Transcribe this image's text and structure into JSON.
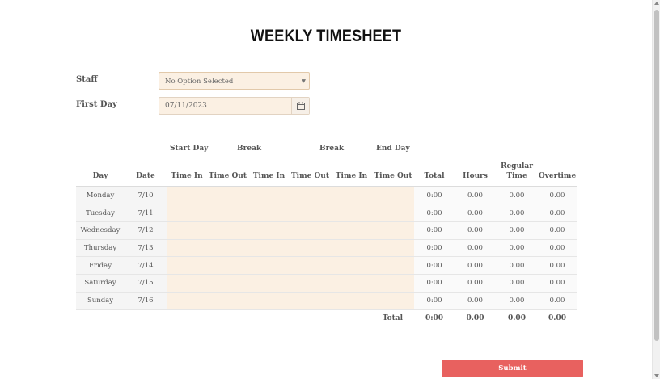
{
  "title": "WEEKLY TIMESHEET",
  "form": {
    "staff_label": "Staff",
    "staff_value": "No Option Selected",
    "first_day_label": "First Day",
    "first_day_value": "07/11/2023"
  },
  "table": {
    "groups": [
      "Start Day",
      "Break",
      "Break",
      "End Day"
    ],
    "columns": [
      "Day",
      "Date",
      "Time In",
      "Time Out",
      "Time In",
      "Time Out",
      "Time In",
      "Time Out",
      "Total",
      "Hours",
      "Regular Time",
      "Overtime"
    ],
    "rows": [
      {
        "day": "Monday",
        "date": "7/10",
        "total": "0:00",
        "hours": "0.00",
        "regular": "0.00",
        "overtime": "0.00"
      },
      {
        "day": "Tuesday",
        "date": "7/11",
        "total": "0:00",
        "hours": "0.00",
        "regular": "0.00",
        "overtime": "0.00"
      },
      {
        "day": "Wednesday",
        "date": "7/12",
        "total": "0:00",
        "hours": "0.00",
        "regular": "0.00",
        "overtime": "0.00"
      },
      {
        "day": "Thursday",
        "date": "7/13",
        "total": "0:00",
        "hours": "0.00",
        "regular": "0.00",
        "overtime": "0.00"
      },
      {
        "day": "Friday",
        "date": "7/14",
        "total": "0:00",
        "hours": "0.00",
        "regular": "0.00",
        "overtime": "0.00"
      },
      {
        "day": "Saturday",
        "date": "7/15",
        "total": "0:00",
        "hours": "0.00",
        "regular": "0.00",
        "overtime": "0.00"
      },
      {
        "day": "Sunday",
        "date": "7/16",
        "total": "0:00",
        "hours": "0.00",
        "regular": "0.00",
        "overtime": "0.00"
      }
    ],
    "footer": {
      "label": "Total",
      "total": "0:00",
      "hours": "0.00",
      "regular": "0.00",
      "overtime": "0.00"
    }
  },
  "submit_label": "Submit",
  "icons": {
    "date_picker": "calendar-icon",
    "select": "caret-down-icon"
  },
  "colors": {
    "input_bg": "#fbf0e3",
    "submit_bg": "#e8615f"
  }
}
